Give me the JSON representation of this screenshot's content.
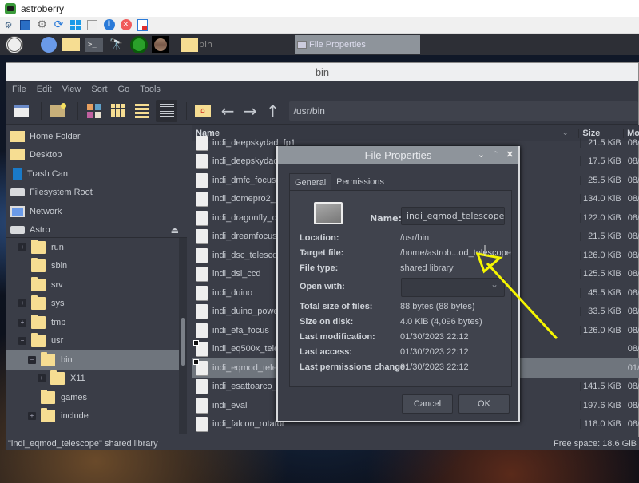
{
  "viewer": {
    "title": "astroberry",
    "toolbar_icons": [
      "connections-icon",
      "fullscreen-icon",
      "settings-icon",
      "refresh-icon",
      "windows-icon",
      "screenshot-icon",
      "info-icon",
      "disconnect-icon",
      "detach-icon"
    ]
  },
  "panel": {
    "launchers": [
      "raspberry-menu-icon",
      "browser-icon",
      "file-manager-icon",
      "terminal-icon",
      "telescope-icon",
      "kstars-icon",
      "planet-icon"
    ],
    "folder_task_label": "bin",
    "task_label": "File Properties"
  },
  "file_manager": {
    "title": "bin",
    "menu": [
      "File",
      "Edit",
      "View",
      "Sort",
      "Go",
      "Tools"
    ],
    "path": "/usr/bin",
    "places": [
      {
        "label": "Home Folder",
        "icon": "home-folder-icon"
      },
      {
        "label": "Desktop",
        "icon": "desktop-icon"
      },
      {
        "label": "Trash Can",
        "icon": "trash-icon"
      },
      {
        "label": "Filesystem Root",
        "icon": "drive-icon"
      },
      {
        "label": "Network",
        "icon": "network-icon"
      },
      {
        "label": "Astro",
        "icon": "drive-icon"
      }
    ],
    "tree": [
      {
        "label": "run",
        "expander": "+",
        "level": 0
      },
      {
        "label": "sbin",
        "expander": "",
        "level": 0
      },
      {
        "label": "srv",
        "expander": "",
        "level": 0
      },
      {
        "label": "sys",
        "expander": "+",
        "level": 0
      },
      {
        "label": "tmp",
        "expander": "+",
        "level": 0
      },
      {
        "label": "usr",
        "expander": "−",
        "level": 0
      },
      {
        "label": "bin",
        "expander": "−",
        "level": 1,
        "selected": true
      },
      {
        "label": "X11",
        "expander": "+",
        "level": 2
      },
      {
        "label": "games",
        "expander": "",
        "level": 1
      },
      {
        "label": "include",
        "expander": "+",
        "level": 1
      }
    ],
    "columns": {
      "name": "Name",
      "size": "Size",
      "modified": "Mo"
    },
    "files": [
      {
        "name": "indi_deepskydad_fp1",
        "size": "21.5 KiB",
        "modified": "08/"
      },
      {
        "name": "indi_deepskydad_fr1",
        "size": "17.5 KiB",
        "modified": "08/"
      },
      {
        "name": "indi_dmfc_focus",
        "size": "25.5 KiB",
        "modified": "08/"
      },
      {
        "name": "indi_domepro2_dome",
        "size": "134.0 KiB",
        "modified": "08/"
      },
      {
        "name": "indi_dragonfly_dome",
        "size": "122.0 KiB",
        "modified": "08/"
      },
      {
        "name": "indi_dreamfocuser_focus",
        "size": "21.5 KiB",
        "modified": "08/"
      },
      {
        "name": "indi_dsc_telescope",
        "size": "126.0 KiB",
        "modified": "08/"
      },
      {
        "name": "indi_dsi_ccd",
        "size": "125.5 KiB",
        "modified": "08/"
      },
      {
        "name": "indi_duino",
        "size": "45.5 KiB",
        "modified": "08/"
      },
      {
        "name": "indi_duino_powerbox",
        "size": "33.5 KiB",
        "modified": "08/"
      },
      {
        "name": "indi_efa_focus",
        "size": "126.0 KiB",
        "modified": "08/"
      },
      {
        "name": "indi_eq500x_telescope",
        "size": "",
        "modified": "08/",
        "link": true
      },
      {
        "name": "indi_eqmod_telescope",
        "size": "",
        "modified": "01/",
        "link": true,
        "selected": true
      },
      {
        "name": "indi_esattoarco_focus",
        "size": "141.5 KiB",
        "modified": "08/"
      },
      {
        "name": "indi_eval",
        "size": "197.6 KiB",
        "modified": "08/"
      },
      {
        "name": "indi_falcon_rotator",
        "size": "118.0 KiB",
        "modified": "08/"
      }
    ],
    "status_left": "\"indi_eqmod_telescope\" shared library",
    "status_right": "Free space: 18.6 GiB"
  },
  "dialog": {
    "title": "File Properties",
    "tabs": [
      "General",
      "Permissions"
    ],
    "name_label": "Name:",
    "name_value": "indi_eqmod_telescope",
    "props": [
      {
        "k": "Location:",
        "v": "/usr/bin"
      },
      {
        "k": "Target file:",
        "v": "/home/astrob...od_telescope"
      },
      {
        "k": "File type:",
        "v": "shared library"
      },
      {
        "k": "Open with:",
        "v": ""
      },
      {
        "k": "Total size of files:",
        "v": "88 bytes (88 bytes)"
      },
      {
        "k": "Size on disk:",
        "v": "4.0 KiB (4,096 bytes)"
      },
      {
        "k": "Last modification:",
        "v": "01/30/2023 22:12"
      },
      {
        "k": "Last access:",
        "v": "01/30/2023 22:12"
      },
      {
        "k": "Last permissions change:",
        "v": "01/30/2023 22:12"
      }
    ],
    "cancel": "Cancel",
    "ok": "OK"
  },
  "annotation": {
    "color": "#f5f500"
  }
}
